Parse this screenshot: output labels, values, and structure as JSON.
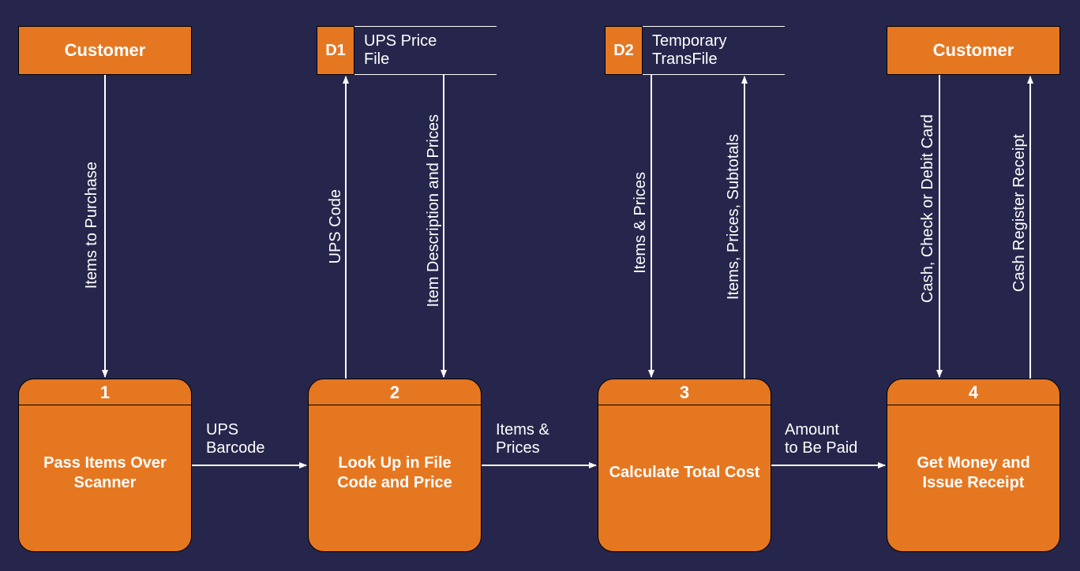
{
  "entities": {
    "customer_left": "Customer",
    "customer_right": "Customer"
  },
  "datastores": {
    "d1": {
      "id": "D1",
      "label": "UPS Price\nFile"
    },
    "d2": {
      "id": "D2",
      "label": "Temporary\nTransFile"
    }
  },
  "processes": {
    "p1": {
      "num": "1",
      "label": "Pass Items Over Scanner"
    },
    "p2": {
      "num": "2",
      "label": "Look Up in File Code and Price"
    },
    "p3": {
      "num": "3",
      "label": "Calculate Total Cost"
    },
    "p4": {
      "num": "4",
      "label": "Get Money and Issue Receipt"
    }
  },
  "flows": {
    "items_to_purchase": "Items to Purchase",
    "ups_barcode": "UPS\nBarcode",
    "ups_code": "UPS Code",
    "item_desc_prices": "Item Description and Prices",
    "items_prices_h": "Items &\nPrices",
    "items_prices_v": "Items & Prices",
    "items_prices_subtotals": "Items, Prices, Subtotals",
    "amount_to_be_paid": "Amount\nto Be Paid",
    "cash_check_debit": "Cash, Check or Debit Card",
    "cash_register_receipt": "Cash Register Receipt"
  }
}
